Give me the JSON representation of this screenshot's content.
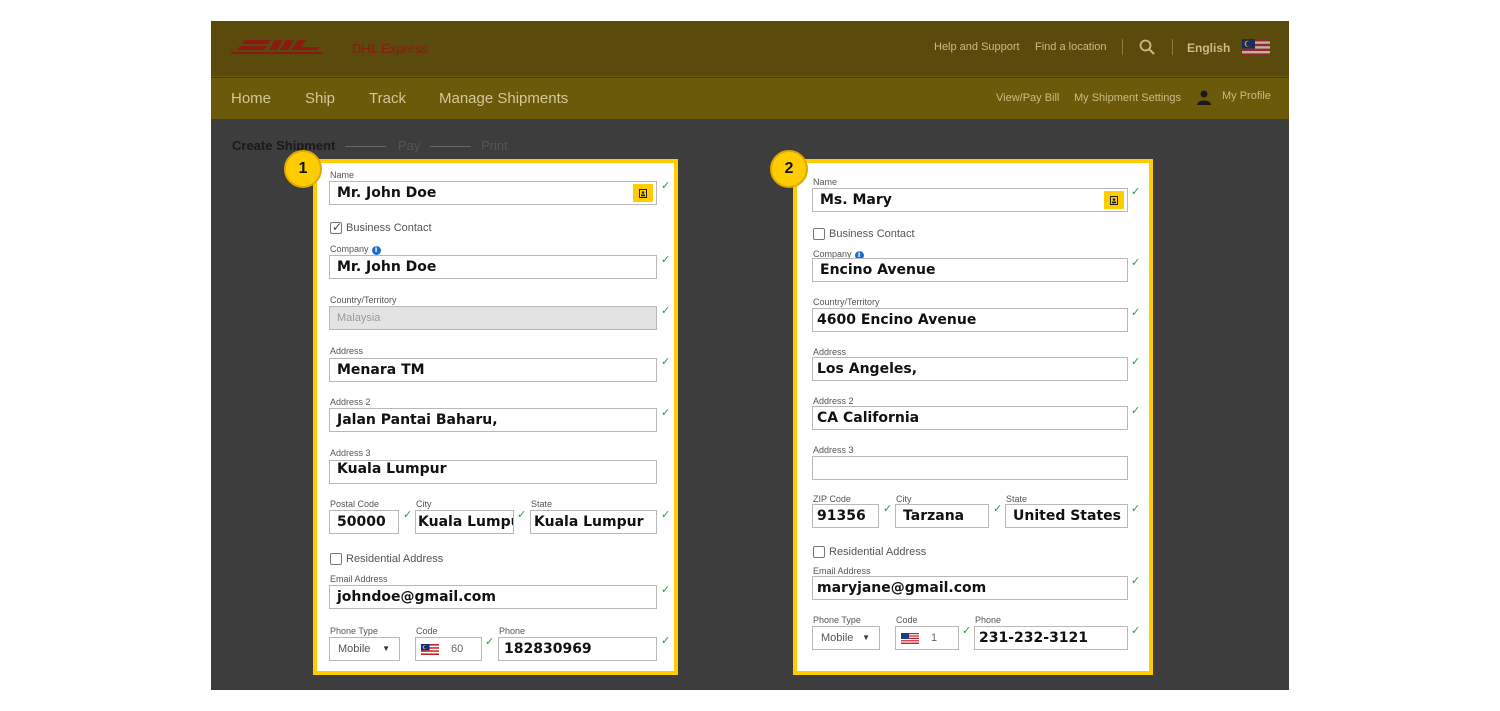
{
  "header": {
    "brand": "DHL Express",
    "utility_links": [
      "Help and Support",
      "Find a location"
    ],
    "language": "English"
  },
  "nav": {
    "items": [
      "Home",
      "Ship",
      "Track",
      "Manage Shipments"
    ],
    "right_links": [
      "View/Pay Bill",
      "My Shipment Settings",
      "My Profile"
    ]
  },
  "steps": [
    "Create Shipment",
    "Pay",
    "Print"
  ],
  "panel1": {
    "badge": "1",
    "name_label": "Name",
    "name_value": "Mr. John Doe",
    "business_contact_label": "Business Contact",
    "business_contact_checked": true,
    "company_label": "Company",
    "company_value": "Mr. John Doe",
    "country_label": "Country/Territory",
    "country_value": "Malaysia",
    "address_label": "Address",
    "address_value": "Menara TM",
    "address2_label": "Address 2",
    "address2_value": "Jalan Pantai Baharu,",
    "address3_label": "Address 3",
    "address3_value": "Kuala Lumpur",
    "postal_label": "Postal Code",
    "postal_value": "50000",
    "city_label": "City",
    "city_value": "Kuala Lumpur",
    "state_label": "State",
    "state_value": "Kuala Lumpur",
    "residential_label": "Residential Address",
    "email_label": "Email Address",
    "email_value": "johndoe@gmail.com",
    "phone_type_label": "Phone Type",
    "phone_type_value": "Mobile",
    "code_label": "Code",
    "code_value": "60",
    "phone_label": "Phone",
    "phone_value": "182830969"
  },
  "panel2": {
    "badge": "2",
    "name_label": "Name",
    "name_value": "Ms. Mary",
    "business_contact_label": "Business Contact",
    "business_contact_checked": false,
    "company_label": "Company",
    "company_value": "Encino Avenue",
    "country_label": "Country/Territory",
    "country_value": "4600 Encino Avenue",
    "address_label": "Address",
    "address_value": "Los Angeles,",
    "address2_label": "Address 2",
    "address2_value": "CA California",
    "address3_label": "Address 3",
    "address3_value": "",
    "postal_label": "ZIP Code",
    "postal_value": "91356",
    "city_label": "City",
    "city_value": "Tarzana",
    "state_label": "State",
    "state_value": "United States",
    "residential_label": "Residential Address",
    "email_label": "Email Address",
    "email_value": "maryjane@gmail.com",
    "phone_type_label": "Phone Type",
    "phone_type_value": "Mobile",
    "code_label": "Code",
    "code_value": "1",
    "phone_label": "Phone",
    "phone_value": "231-232-3121"
  },
  "colors": {
    "dhl_yellow": "#ffcc00",
    "dhl_red": "#d40511",
    "check_green": "#1ba33a",
    "overlay_bg": "#3d3d3d"
  },
  "icons": [
    "dhl-logo",
    "search-icon",
    "malaysia-flag-icon",
    "user-icon",
    "contact-book-icon",
    "info-icon",
    "check-icon",
    "us-flag-icon",
    "caret-down-icon"
  ]
}
